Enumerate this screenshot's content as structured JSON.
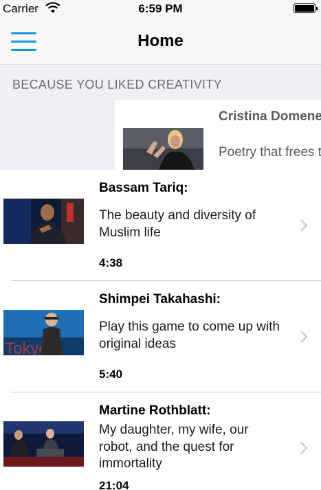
{
  "status_bar": {
    "carrier": "Carrier",
    "time": "6:59 PM"
  },
  "nav": {
    "title": "Home"
  },
  "section": {
    "title": "BECAUSE YOU LIKED CREATIVITY",
    "featured": {
      "speaker": "Cristina Domenech:",
      "title": "Poetry that frees the soul"
    }
  },
  "talks": [
    {
      "speaker": "Bassam Tariq:",
      "title": "The beauty and diversity of Muslim life",
      "duration": "4:38"
    },
    {
      "speaker": "Shimpei Takahashi:",
      "title": "Play this game to come up with original ideas",
      "duration": "5:40"
    },
    {
      "speaker": "Martine Rothblatt:",
      "title": "My daughter, my wife, our robot, and the quest for immortality",
      "duration": "21:04"
    }
  ],
  "thumbnail_overlay_text": "Tokyo",
  "colors": {
    "accent": "#1a94d8",
    "chevron": "#c7c7cc"
  },
  "icons": {
    "menu": "hamburger-icon",
    "wifi": "wifi-icon",
    "battery": "battery-icon",
    "disclosure": "chevron-right-icon"
  }
}
